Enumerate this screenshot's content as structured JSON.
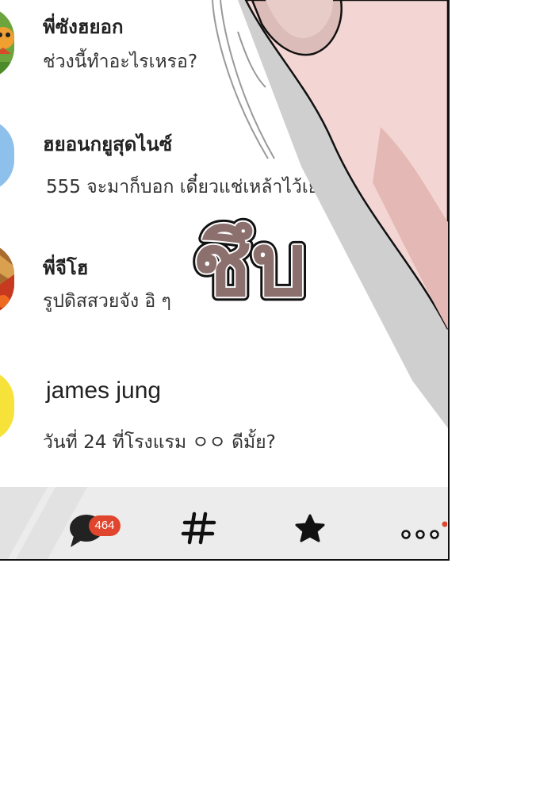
{
  "chats": [
    {
      "name": "พี่ซังฮยอก",
      "preview": "ช่วงนี้ทำอะไรเหรอ?"
    },
    {
      "name": "ฮยอนกยูสุดไนซ์",
      "preview": "555 จะมาก็บอก เดี๋ยวแช่เหล้าไว้เย็น"
    },
    {
      "name": "พี่จีโฮ",
      "preview": "รูปดิสสวยจัง อิ ๆ"
    },
    {
      "name": "james jung",
      "preview": "วันที่ 24 ที่โรงแรม ㅇㅇ ดีมั้ย?"
    }
  ],
  "tabs": {
    "chats_badge": "464",
    "tab_icons": [
      "chat-bubble-icon",
      "hashtag-icon",
      "star-icon",
      "more-icon"
    ]
  },
  "sfx": "ชึบ",
  "colors": {
    "badge": "#e0452d",
    "sfx_fill": "#8c706e",
    "bar": "#ececec",
    "avatar_blue": "#8ec0ec",
    "avatar_yellow": "#f7e23a"
  }
}
